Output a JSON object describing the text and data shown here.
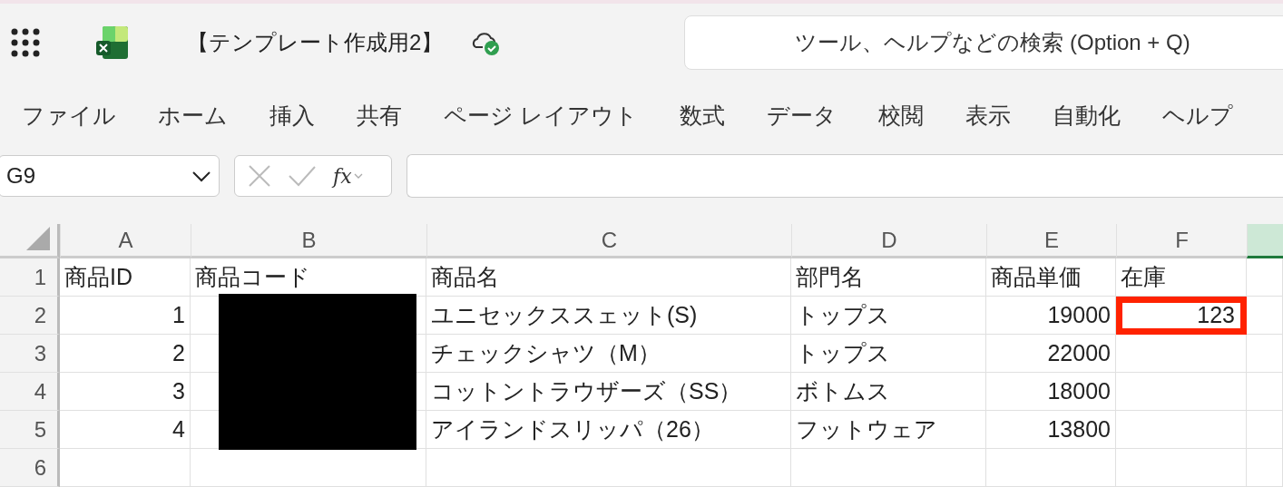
{
  "title_bar": {
    "document_title": "【テンプレート作成用2】",
    "search_placeholder": "ツール、ヘルプなどの検索 (Option + Q)"
  },
  "menu": [
    "ファイル",
    "ホーム",
    "挿入",
    "共有",
    "ページ レイアウト",
    "数式",
    "データ",
    "校閲",
    "表示",
    "自動化",
    "ヘルプ"
  ],
  "formula_bar": {
    "name_box": "G9",
    "function_label": "fx"
  },
  "sheet": {
    "columns": [
      {
        "label": "A",
        "selected": false
      },
      {
        "label": "B",
        "selected": false
      },
      {
        "label": "C",
        "selected": false
      },
      {
        "label": "D",
        "selected": false
      },
      {
        "label": "E",
        "selected": false
      },
      {
        "label": "F",
        "selected": false
      },
      {
        "selected": true
      }
    ],
    "rows": [
      {
        "number": "1",
        "cells": [
          {
            "kind": "text",
            "text": "商品ID",
            "marked": false
          },
          {
            "kind": "text",
            "text": "商品コード",
            "marked": false
          },
          {
            "kind": "text",
            "text": "商品名",
            "marked": false
          },
          {
            "kind": "text",
            "text": "部門名",
            "marked": false
          },
          {
            "kind": "text",
            "text": "商品単価",
            "marked": false
          },
          {
            "kind": "text",
            "text": "在庫",
            "marked": false
          },
          {
            "kind": "blank",
            "marked": false
          }
        ]
      },
      {
        "number": "2",
        "cells": [
          {
            "kind": "number",
            "text": "1",
            "marked": false
          },
          {
            "kind": "redacted",
            "marked": false
          },
          {
            "kind": "text",
            "text": "ユニセックススェット(S)",
            "marked": false
          },
          {
            "kind": "text",
            "text": "トップス",
            "marked": false
          },
          {
            "kind": "number",
            "text": "19000",
            "marked": false
          },
          {
            "kind": "number",
            "text": "123",
            "marked": true
          },
          {
            "kind": "blank",
            "marked": false
          }
        ]
      },
      {
        "number": "3",
        "cells": [
          {
            "kind": "number",
            "text": "2",
            "marked": false
          },
          {
            "kind": "redacted",
            "marked": false
          },
          {
            "kind": "text",
            "text": "チェックシャツ（M）",
            "marked": false
          },
          {
            "kind": "text",
            "text": "トップス",
            "marked": false
          },
          {
            "kind": "number",
            "text": "22000",
            "marked": false
          },
          {
            "kind": "blank",
            "marked": false
          },
          {
            "kind": "blank",
            "marked": false
          }
        ]
      },
      {
        "number": "4",
        "cells": [
          {
            "kind": "number",
            "text": "3",
            "marked": false
          },
          {
            "kind": "redacted",
            "marked": false
          },
          {
            "kind": "text",
            "text": "コットントラウザーズ（SS）",
            "marked": false
          },
          {
            "kind": "text",
            "text": "ボトムス",
            "marked": false
          },
          {
            "kind": "number",
            "text": "18000",
            "marked": false
          },
          {
            "kind": "blank",
            "marked": false
          },
          {
            "kind": "blank",
            "marked": false
          }
        ]
      },
      {
        "number": "5",
        "cells": [
          {
            "kind": "number",
            "text": "4",
            "marked": false
          },
          {
            "kind": "redacted",
            "marked": false
          },
          {
            "kind": "text",
            "text": "アイランドスリッパ（26）",
            "marked": false
          },
          {
            "kind": "text",
            "text": "フットウェア",
            "marked": false
          },
          {
            "kind": "number",
            "text": "13800",
            "marked": false
          },
          {
            "kind": "blank",
            "marked": false
          },
          {
            "kind": "blank",
            "marked": false
          }
        ]
      },
      {
        "number": "6",
        "cells": [
          {
            "kind": "blank",
            "marked": false
          },
          {
            "kind": "blank",
            "marked": false
          },
          {
            "kind": "blank",
            "marked": false
          },
          {
            "kind": "blank",
            "marked": false
          },
          {
            "kind": "blank",
            "marked": false
          },
          {
            "kind": "blank",
            "marked": false
          },
          {
            "kind": "blank",
            "marked": false
          }
        ]
      }
    ]
  }
}
